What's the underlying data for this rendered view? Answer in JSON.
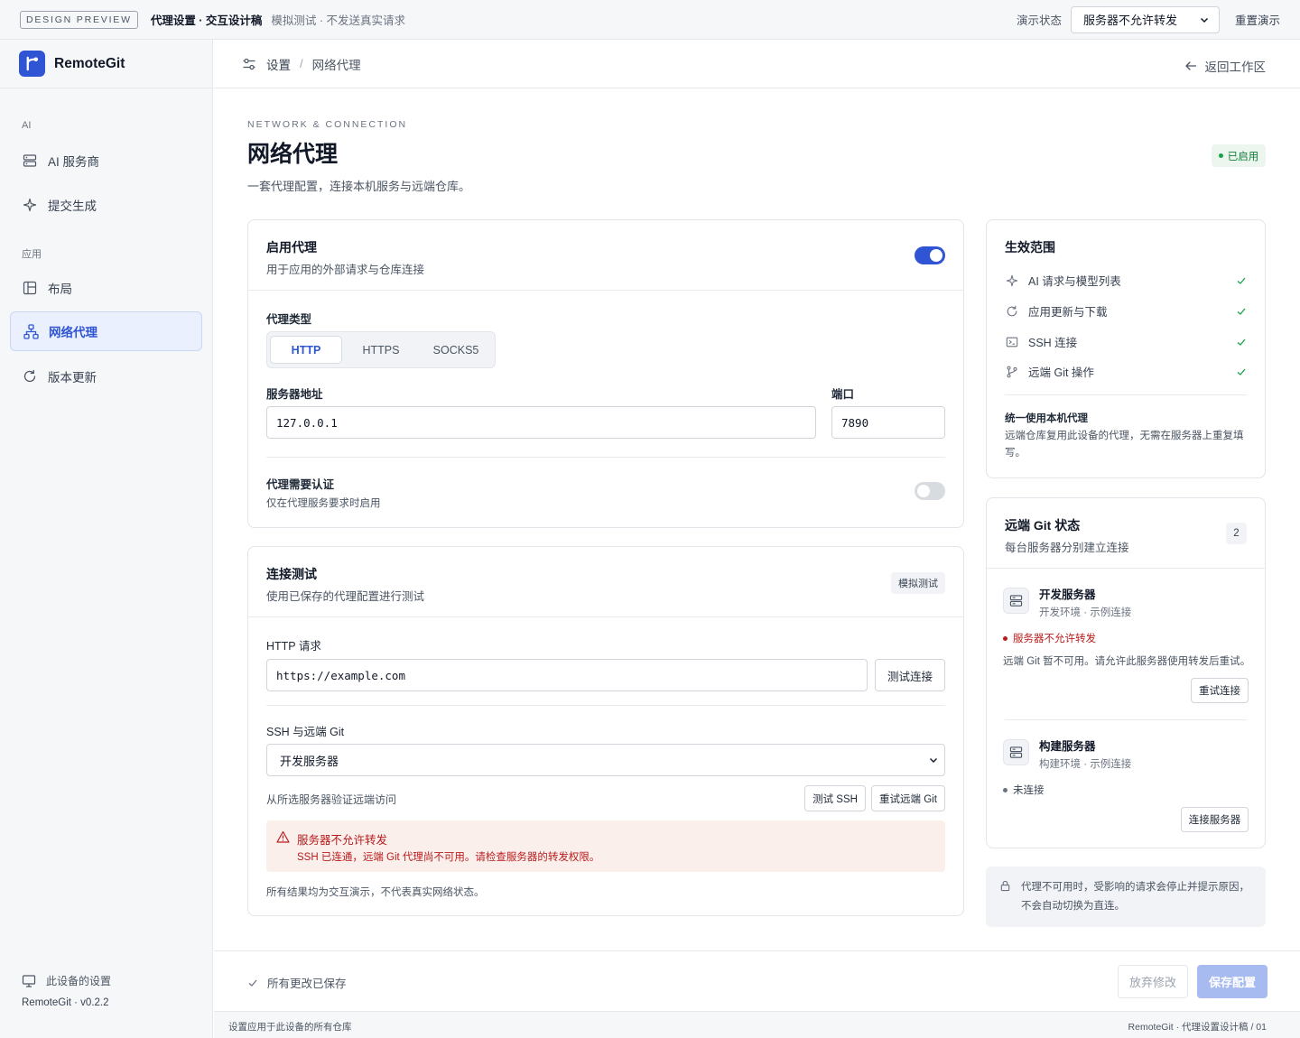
{
  "topbar": {
    "badge": "DESIGN PREVIEW",
    "title": "代理设置 · 交互设计稿",
    "subtitle": "模拟测试 · 不发送真实请求",
    "demo_state_label": "演示状态",
    "demo_state_value": "服务器不允许转发",
    "reset_label": "重置演示"
  },
  "sidebar": {
    "brand": "RemoteGit",
    "sections": [
      {
        "title": "AI",
        "items": [
          {
            "label": "AI 服务商",
            "icon": "server-icon"
          },
          {
            "label": "提交生成",
            "icon": "sparkle-icon"
          }
        ]
      },
      {
        "title": "应用",
        "items": [
          {
            "label": "布局",
            "icon": "layout-icon"
          },
          {
            "label": "网络代理",
            "icon": "network-icon",
            "active": true
          },
          {
            "label": "版本更新",
            "icon": "refresh-icon"
          }
        ]
      }
    ],
    "device_settings": "此设备的设置",
    "version": "RemoteGit · v0.2.2"
  },
  "breadcrumb": {
    "root": "设置",
    "current": "网络代理",
    "back": "返回工作区"
  },
  "page": {
    "eyebrow": "NETWORK & CONNECTION",
    "title": "网络代理",
    "description": "一套代理配置，连接本机服务与远端仓库。",
    "status_badge": "已启用"
  },
  "proxy_card": {
    "title": "启用代理",
    "subtitle": "用于应用的外部请求与仓库连接",
    "enabled": true,
    "type_label": "代理类型",
    "types": [
      "HTTP",
      "HTTPS",
      "SOCKS5"
    ],
    "selected_type": "HTTP",
    "host_label": "服务器地址",
    "host_value": "127.0.0.1",
    "port_label": "端口",
    "port_value": "7890",
    "auth_title": "代理需要认证",
    "auth_subtitle": "仅在代理服务要求时启用",
    "auth_enabled": false
  },
  "test_card": {
    "title": "连接测试",
    "subtitle": "使用已保存的代理配置进行测试",
    "chip": "模拟测试",
    "http_label": "HTTP 请求",
    "http_value": "https://example.com",
    "test_button": "测试连接",
    "ssh_label": "SSH 与远端 Git",
    "ssh_selected": "开发服务器",
    "ssh_hint": "从所选服务器验证远端访问",
    "test_ssh_button": "测试 SSH",
    "retry_git_button": "重试远端 Git",
    "alert_title": "服务器不允许转发",
    "alert_body": "SSH 已连通，远端 Git 代理尚不可用。请检查服务器的转发权限。",
    "footnote": "所有结果均为交互演示，不代表真实网络状态。"
  },
  "scope_card": {
    "title": "生效范围",
    "items": [
      {
        "label": "AI 请求与模型列表",
        "icon": "sparkle-icon"
      },
      {
        "label": "应用更新与下载",
        "icon": "refresh-icon"
      },
      {
        "label": "SSH 连接",
        "icon": "terminal-icon"
      },
      {
        "label": "远端 Git 操作",
        "icon": "git-branch-icon"
      }
    ],
    "note_title": "统一使用本机代理",
    "note_body": "远端仓库复用此设备的代理，无需在服务器上重复填写。"
  },
  "git_card": {
    "title": "远端 Git 状态",
    "subtitle": "每台服务器分别建立连接",
    "count": "2",
    "servers": [
      {
        "name": "开发服务器",
        "meta": "开发环境 · 示例连接",
        "status": "服务器不允许转发",
        "status_color": "#b91c1c",
        "detail": "远端 Git 暂不可用。请允许此服务器使用转发后重试。",
        "action": "重试连接"
      },
      {
        "name": "构建服务器",
        "meta": "构建环境 · 示例连接",
        "status": "未连接",
        "status_color": "#6b7280",
        "detail": "",
        "action": "连接服务器"
      }
    ]
  },
  "notice": "代理不可用时，受影响的请求会停止并提示原因，不会自动切换为直连。",
  "savebar": {
    "status": "所有更改已保存",
    "discard": "放弃修改",
    "save": "保存配置"
  },
  "statusbar": {
    "left": "设置应用于此设备的所有仓库",
    "right": "RemoteGit · 代理设置设计稿 / 01"
  },
  "colors": {
    "accent": "#2f55d4",
    "success": "#16a34a",
    "danger": "#b91c1c"
  }
}
